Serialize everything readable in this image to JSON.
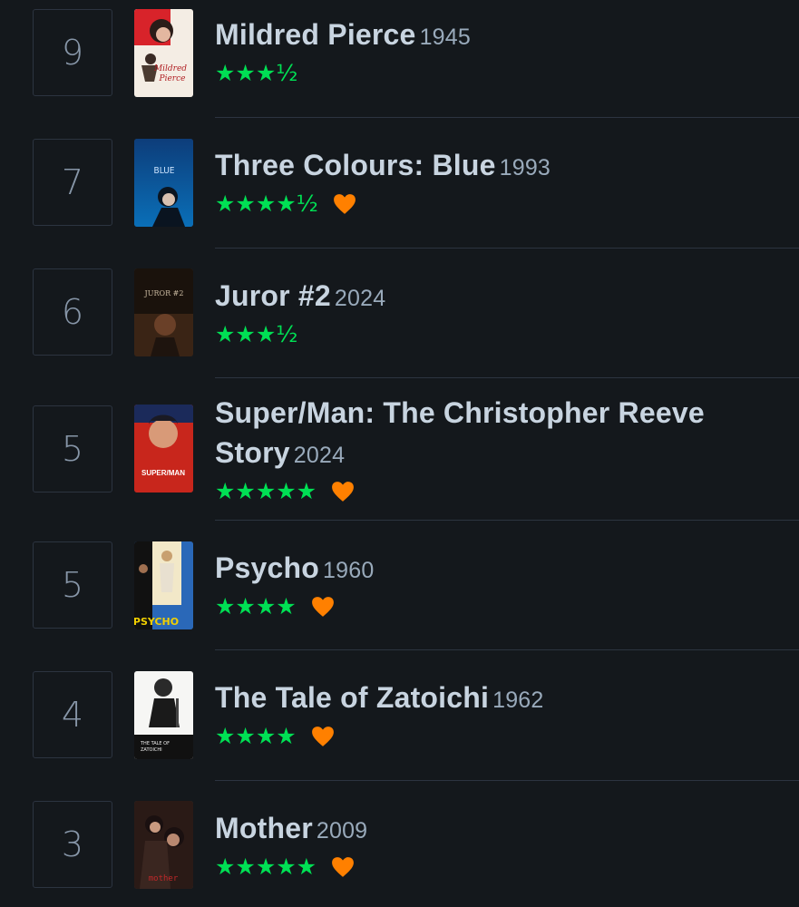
{
  "entries": [
    {
      "day": "9",
      "title": "Mildred Pierce",
      "year": "1945",
      "stars": "★★★½",
      "liked": false,
      "poster_text": "Mildred Pierce"
    },
    {
      "day": "7",
      "title": "Three Colours: Blue",
      "year": "1993",
      "stars": "★★★★½",
      "liked": true,
      "poster_text": "BLUE"
    },
    {
      "day": "6",
      "title": "Juror #2",
      "year": "2024",
      "stars": "★★★½",
      "liked": false,
      "poster_text": "JUROR #2"
    },
    {
      "day": "5",
      "title": "Super/Man: The Christopher Reeve Story",
      "year": "2024",
      "stars": "★★★★★",
      "liked": true,
      "poster_text": "SUPER/MAN"
    },
    {
      "day": "5",
      "title": "Psycho",
      "year": "1960",
      "stars": "★★★★",
      "liked": true,
      "poster_text": "PSYCHO"
    },
    {
      "day": "4",
      "title": "The Tale of Zatoichi",
      "year": "1962",
      "stars": "★★★★",
      "liked": true,
      "poster_text": "THE TALE OF ZATOICHI"
    },
    {
      "day": "3",
      "title": "Mother",
      "year": "2009",
      "stars": "★★★★★",
      "liked": true,
      "poster_text": "mother"
    }
  ],
  "colors": {
    "background": "#14181c",
    "star_green": "#00e054",
    "heart_orange": "#ff8000",
    "title_text": "#c8d4e0",
    "divider": "#2c3440"
  },
  "icons": {
    "heart": "heart-icon",
    "star": "star-icon"
  }
}
